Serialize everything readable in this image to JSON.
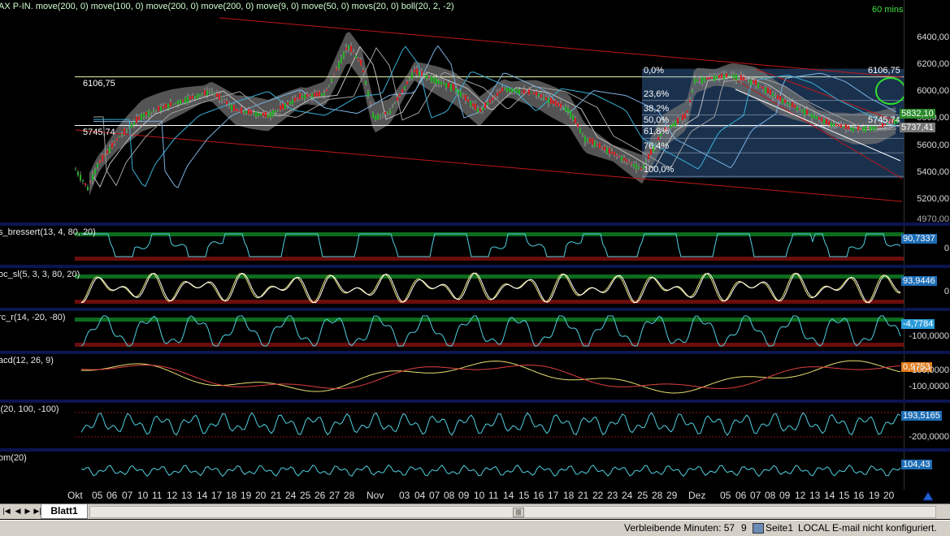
{
  "main_chart": {
    "title": "AX P-IN. move(200, 0) move(100, 0) move(200, 0) move(200, 0) move(9, 0) move(50, 0) movs(20, 0) boll(20, 2, -2)",
    "timeframe": "60 mins",
    "price_ticks": [
      "6400,00",
      "6200,00",
      "6000,00",
      "5800,00",
      "5600,00",
      "5400,00",
      "5200,00"
    ],
    "bottom_tick": "4970,00",
    "level_high_label": "6106,75",
    "level_low_label": "5745,74",
    "level_high_right": "6106,75",
    "level_low_right": "5745,74",
    "fib_levels": [
      "0,0%",
      "23,6%",
      "38,2%",
      "50,0%",
      "61,8%",
      "76,4%",
      "100,0%"
    ],
    "last_price_green": "5832,10",
    "last_price_gray": "5737,41"
  },
  "indicators": [
    {
      "title": "s_bressert(13, 4, 80, 20)",
      "value": "90,7337",
      "value_bg": "#1d6db5",
      "ticks": [
        "0"
      ]
    },
    {
      "title": "oc_sl(5, 3, 3, 80, 20)",
      "value": "93,9446",
      "value_bg": "#1d6db5",
      "ticks": [
        "0"
      ]
    },
    {
      "title": "rc_r(14, -20, -80)",
      "value": "-4,7784",
      "value_bg": "#2a9bd8",
      "ticks": [
        "-100,0000"
      ]
    },
    {
      "title": "acd(12, 26, 9)",
      "value": "0,9753",
      "value_bg": "#e07b1a",
      "ticks": [
        "100,0000",
        "-100,0000"
      ]
    },
    {
      "title": "i(20, 100, -100)",
      "value": "193,5165",
      "value_bg": "#1d6db5",
      "ticks": [
        "-200,0000"
      ]
    },
    {
      "title": "om(20)",
      "value": "104,43",
      "value_bg": "#1d6db5",
      "ticks": []
    }
  ],
  "x_axis": [
    "Okt",
    "05",
    "06",
    "07",
    "10",
    "11",
    "12",
    "13",
    "14",
    "17",
    "18",
    "19",
    "20",
    "21",
    "24",
    "25",
    "26",
    "27",
    "28",
    "Nov",
    "03",
    "04",
    "07",
    "08",
    "09",
    "10",
    "11",
    "14",
    "15",
    "16",
    "17",
    "18",
    "21",
    "22",
    "23",
    "24",
    "25",
    "28",
    "29",
    "Dez",
    "05",
    "06",
    "07",
    "08",
    "09",
    "12",
    "13",
    "14",
    "15",
    "16",
    "19",
    "20"
  ],
  "tabs": {
    "sheet": "Blatt1"
  },
  "status": {
    "remaining": "Verbleibende Minuten: 57",
    "num": "9",
    "page": "Seite1",
    "mode": "LOCAL",
    "email": "E-mail nicht konfiguriert."
  },
  "colors": {
    "up": "#22b422",
    "down": "#e02020",
    "bollinger": "#707070",
    "fib_box": "#1e3a5c",
    "channel": "#c01818",
    "osc": "#50d0e0"
  },
  "icons": [
    "first-sheet-icon",
    "prev-sheet-icon",
    "next-sheet-icon",
    "last-sheet-icon",
    "drawing-tool-icon",
    "print-icon"
  ]
}
